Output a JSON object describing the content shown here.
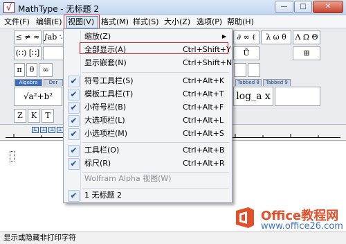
{
  "window": {
    "title": "MathType - 无标题 2",
    "minimize_glyph": "—",
    "maximize_glyph": "□",
    "close_glyph": "✕"
  },
  "menubar": {
    "items": [
      "文件(F)",
      "编辑(E)",
      "视图(V)",
      "格式(M)",
      "样式(S)",
      "大小(Z)",
      "选项(P)",
      "帮助(H)"
    ],
    "active": "视图(V)"
  },
  "toolbar": {
    "row1": [
      "≤ ≠ ≈",
      "∫ab ∵",
      "",
      "",
      "",
      "",
      "",
      "",
      "",
      "",
      "∂ ∞ ℓ",
      "λ ω θ",
      "Λ Ω Θ"
    ],
    "row2": [
      "(∷) [∷]",
      "",
      "",
      "",
      "",
      "",
      "",
      "",
      "",
      "",
      "",
      "Ů",
      "⊞"
    ],
    "row3": [
      "π",
      "θ",
      "∞"
    ],
    "tabs": [
      "Algebra",
      "Der",
      "Tabbed 8",
      "Tabbed 9"
    ],
    "big_left": "√a²+b²",
    "big_right": "log_a x",
    "row5": [
      "Z",
      "K",
      "T"
    ],
    "row6": [
      "Z",
      "K",
      "T"
    ]
  },
  "ruler": {
    "buttons": [
      "L",
      "⊥",
      "⊥",
      "⊥",
      "⊥"
    ]
  },
  "statusbar": {
    "text": "显示或隐藏非打印字符"
  },
  "view_menu": {
    "items": [
      {
        "label": "缩放(Z)",
        "shortcut": "",
        "checked": false,
        "submenu": true,
        "disabled": false
      },
      {
        "label": "全部显示(A)",
        "shortcut": "Ctrl+Shift+Y",
        "checked": false,
        "submenu": false,
        "disabled": false
      },
      {
        "label": "显示嵌套(N)",
        "shortcut": "Ctrl+Shift+N",
        "checked": false,
        "submenu": false,
        "disabled": false
      },
      {
        "label": "符号工具栏(S)",
        "shortcut": "Ctrl+Alt+K",
        "checked": true,
        "submenu": false,
        "disabled": false
      },
      {
        "label": "模板工具栏(T)",
        "shortcut": "Ctrl+Alt+T",
        "checked": true,
        "submenu": false,
        "disabled": false
      },
      {
        "label": "小符号栏(B)",
        "shortcut": "Ctrl+Alt+F",
        "checked": true,
        "submenu": false,
        "disabled": false
      },
      {
        "label": "大选项栏(L)",
        "shortcut": "Ctrl+Alt+L",
        "checked": true,
        "submenu": false,
        "disabled": false
      },
      {
        "label": "小选项栏(M)",
        "shortcut": "Ctrl+Alt+S",
        "checked": true,
        "submenu": false,
        "disabled": false
      },
      {
        "label": "工具栏(O)",
        "shortcut": "Ctrl+Alt+B",
        "checked": true,
        "submenu": false,
        "disabled": false
      },
      {
        "label": "标尺(R)",
        "shortcut": "Ctrl+Alt+R",
        "checked": true,
        "submenu": false,
        "disabled": false
      },
      {
        "label": "Wolfram Alpha 视图(W)",
        "shortcut": "",
        "checked": false,
        "submenu": false,
        "disabled": true
      },
      {
        "label": "1 无标题 2",
        "shortcut": "",
        "checked": true,
        "submenu": false,
        "disabled": false
      }
    ],
    "check_glyph": "✔",
    "submenu_glyph": "▶"
  },
  "watermark": {
    "brand": "Office教程网",
    "url": "www.office26.com",
    "colors": {
      "orange": "#e1502a",
      "blue": "#3b74c4"
    }
  }
}
